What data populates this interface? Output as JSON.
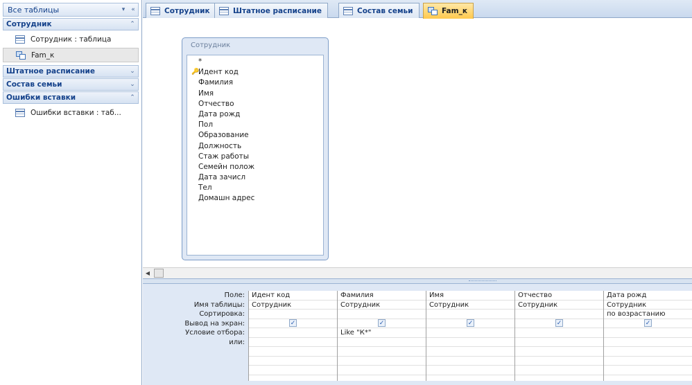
{
  "nav": {
    "header_title": "Все таблицы",
    "header_dropdown_icon": "▾",
    "header_collapse_icon": "«",
    "groups": [
      {
        "label": "Сотрудник",
        "state": "expanded",
        "chev": "⌃",
        "items": [
          {
            "label": "Сотрудник : таблица",
            "icon": "table-icon"
          },
          {
            "label": "Fam_к",
            "icon": "query-icon",
            "selected": true
          }
        ]
      },
      {
        "label": "Штатное расписание",
        "state": "collapsed",
        "chev": "⌄",
        "items": []
      },
      {
        "label": "Состав семьи",
        "state": "collapsed",
        "chev": "⌄",
        "items": []
      },
      {
        "label": "Ошибки вставки",
        "state": "expanded",
        "chev": "⌃",
        "items": [
          {
            "label": "Ошибки вставки : таб...",
            "icon": "table-icon"
          }
        ]
      }
    ]
  },
  "tabs": [
    {
      "label": "Сотрудник",
      "icon": "table-icon"
    },
    {
      "label": "Штатное расписание",
      "icon": "table-icon"
    },
    {
      "label": "Состав семьи",
      "icon": "table-icon"
    },
    {
      "label": "Fam_к",
      "icon": "query-icon",
      "active": true
    }
  ],
  "field_list": {
    "caption": "Сотрудник",
    "fields": [
      "*",
      "Идент код",
      "Фамилия",
      "Имя",
      "Отчество",
      "Дата рожд",
      "Пол",
      "Образование",
      "Должность",
      "Стаж работы",
      "Семейн полож",
      "Дата зачисл",
      "Тел",
      "Домашн адрес"
    ],
    "key_field": "Идент код"
  },
  "qbe": {
    "row_labels": [
      "Поле:",
      "Имя таблицы:",
      "Сортировка:",
      "Вывод на экран:",
      "Условие отбора:",
      "или:",
      "",
      "",
      ""
    ],
    "columns": [
      {
        "field": "Идент код",
        "table": "Сотрудник",
        "sort": "",
        "show": true,
        "criteria": "",
        "or": ""
      },
      {
        "field": "Фамилия",
        "table": "Сотрудник",
        "sort": "",
        "show": true,
        "criteria": "Like \"К*\"",
        "or": ""
      },
      {
        "field": "Имя",
        "table": "Сотрудник",
        "sort": "",
        "show": true,
        "criteria": "",
        "or": ""
      },
      {
        "field": "Отчество",
        "table": "Сотрудник",
        "sort": "",
        "show": true,
        "criteria": "",
        "or": ""
      },
      {
        "field": "Дата рожд",
        "table": "Сотрудник",
        "sort": "по возрастанию",
        "show": true,
        "criteria": "",
        "or": ""
      }
    ],
    "check_glyph": "✓"
  },
  "colors": {
    "accent": "#15428b",
    "active_tab": "#ffc94d",
    "pane_bg": "#dfe8f5"
  }
}
